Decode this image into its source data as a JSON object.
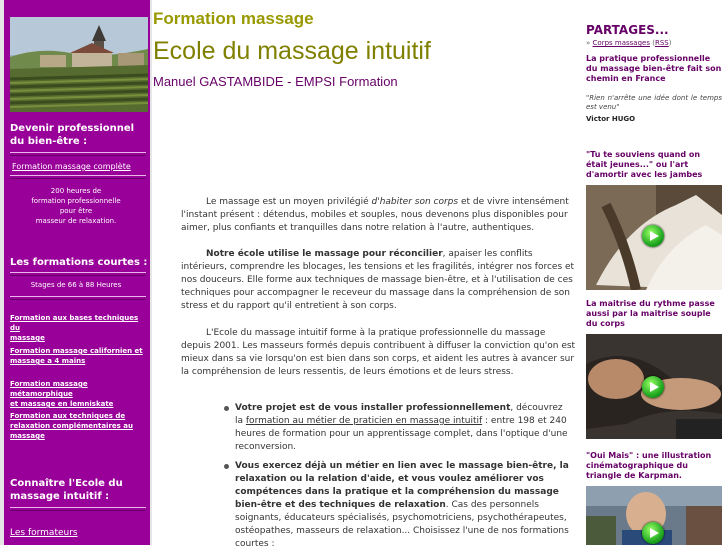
{
  "sidebar": {
    "devenir_heading_1": "Devenir professionnel",
    "devenir_heading_2": "du bien-être :",
    "formation_link": "Formation massage complète",
    "formation_desc_1": "200 heures de",
    "formation_desc_2": "formation professionnelle",
    "formation_desc_3": "pour être",
    "formation_desc_4": "masseur de relaxation.",
    "courtes_heading": "Les formations courtes :",
    "stages_text": "Stages de 66 à 88 Heures",
    "links": [
      [
        "Formation aux bases techniques du",
        "massage"
      ],
      [
        "Formation massage californien et",
        "massage a 4 mains"
      ],
      [
        "Formation massage métamorphique",
        "et massage en lemniskate"
      ],
      [
        "Formation aux techniques de",
        "relaxation complémentaires au",
        "massage"
      ]
    ],
    "connaitre_1": "Connaître l'Ecole du",
    "connaitre_2": "massage intuitif :",
    "formateurs_link": "Les formateurs"
  },
  "header": {
    "title": "Formation massage",
    "school": "Ecole du massage intuitif",
    "subtitle": "Manuel GASTAMBIDE - EMPSI Formation"
  },
  "main": {
    "p1_start": "Le massage est un moyen privilégié ",
    "p1_em": "d'habiter son corps",
    "p1_end": " et de vivre intensément l'instant présent : détendus, mobiles et souples, nous devenons plus disponibles pour aimer, plus confiants et tranquilles dans notre relation à l'autre, authentiques.",
    "p2_bold": "Notre école utilise le massage pour réconcilier",
    "p2_rest": ", apaiser les conflits intérieurs, comprendre les blocages, les tensions et les fragilités, intégrer nos forces et nos douceurs. Elle forme aux techniques de massage bien-être, et à l'utilisation de ces techniques pour accompagner le receveur du massage dans la compréhension de son stress et du rapport qu'il entretient à son corps.",
    "p3": "L'Ecole du massage intuitif forme à la pratique professionnelle du massage depuis 2001. Les masseurs formés  depuis contribuent à diffuser la conviction qu'on est mieux dans sa vie lorsqu'on est bien dans son corps, et aident les autres à avancer sur la compréhension de leurs ressentis, de leurs émotions et de leurs stress.",
    "b1_bold": "Votre projet est de vous installer professionnellement",
    "b1_mid": ", découvrez la ",
    "b1_link": "formation au métier de praticien en massage intuitif",
    "b1_end": " : entre 198 et 240 heures de formation pour un apprentissage complet, dans l'optique d'une reconversion.",
    "b2_bold": "Vous exercez déjà un métier en lien avec le massage bien-être, la relaxation ou la relation d'aide, et vous voulez améliorer vos compétences dans la pratique et la compréhension du massage bien-être et des techniques de relaxation",
    "b2_rest": ". Cas des personnels soignants, éducateurs spécialisés, psychomotriciens, psychothérapeutes, ostéopathes, masseurs de relaxation... Choisissez l'une de nos formations courtes :"
  },
  "right": {
    "partages": "PARTAGES...",
    "feed_bullet": "»",
    "feed_link": "Corps massages",
    "feed_rss": "RSS",
    "article1": "La pratique professionnelle du massage bien-être fait son chemin en France",
    "quote": "\"Rien n'arrête une idée dont le temps est venu\"",
    "quote_author": "Victor HUGO",
    "article2": "\"Tu te souviens quand on était jeunes...\" ou l'art d'amortir avec les jambes",
    "article3": "La maitrise du rythme passe aussi par la maitrise souple du corps",
    "article4": "\"Oui Mais\" : une illustration cinématographique du triangle de Karpman."
  },
  "colors": {
    "sidebar_purple": "#990099",
    "title_olive": "#999900",
    "right_heading": "#660066",
    "play_green": "#22aa22"
  }
}
